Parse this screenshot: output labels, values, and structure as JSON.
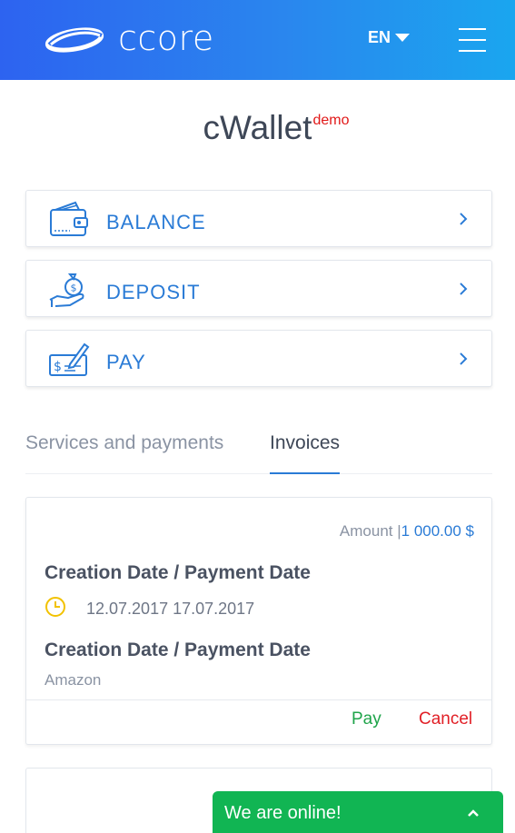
{
  "header": {
    "logo_text": "ccore",
    "language": "EN"
  },
  "title": {
    "text": "cWallet",
    "badge": "demo"
  },
  "actions": [
    {
      "label": "BALANCE",
      "icon": "wallet-icon"
    },
    {
      "label": "DEPOSIT",
      "icon": "money-bag-hand-icon"
    },
    {
      "label": "PAY",
      "icon": "check-pen-icon"
    }
  ],
  "tabs": [
    {
      "label": "Services and payments",
      "active": false
    },
    {
      "label": "Invoices",
      "active": true
    }
  ],
  "invoice": {
    "amount_label": "Amount |",
    "amount_value": "1 000.00 $",
    "heading_1": "Creation Date / Payment Date",
    "dates": "12.07.2017 17.07.2017",
    "heading_2": "Creation Date / Payment Date",
    "merchant": "Amazon",
    "pay_label": "Pay",
    "cancel_label": "Cancel"
  },
  "chat": {
    "label": "We are online!"
  },
  "colors": {
    "accent": "#2a7bd6",
    "header_start": "#2d63f0",
    "header_end": "#1aa6ef",
    "demo": "#e11818",
    "pay": "#1fa44a",
    "cancel": "#e11f26",
    "chat": "#11b553",
    "clock": "#f2c200"
  }
}
